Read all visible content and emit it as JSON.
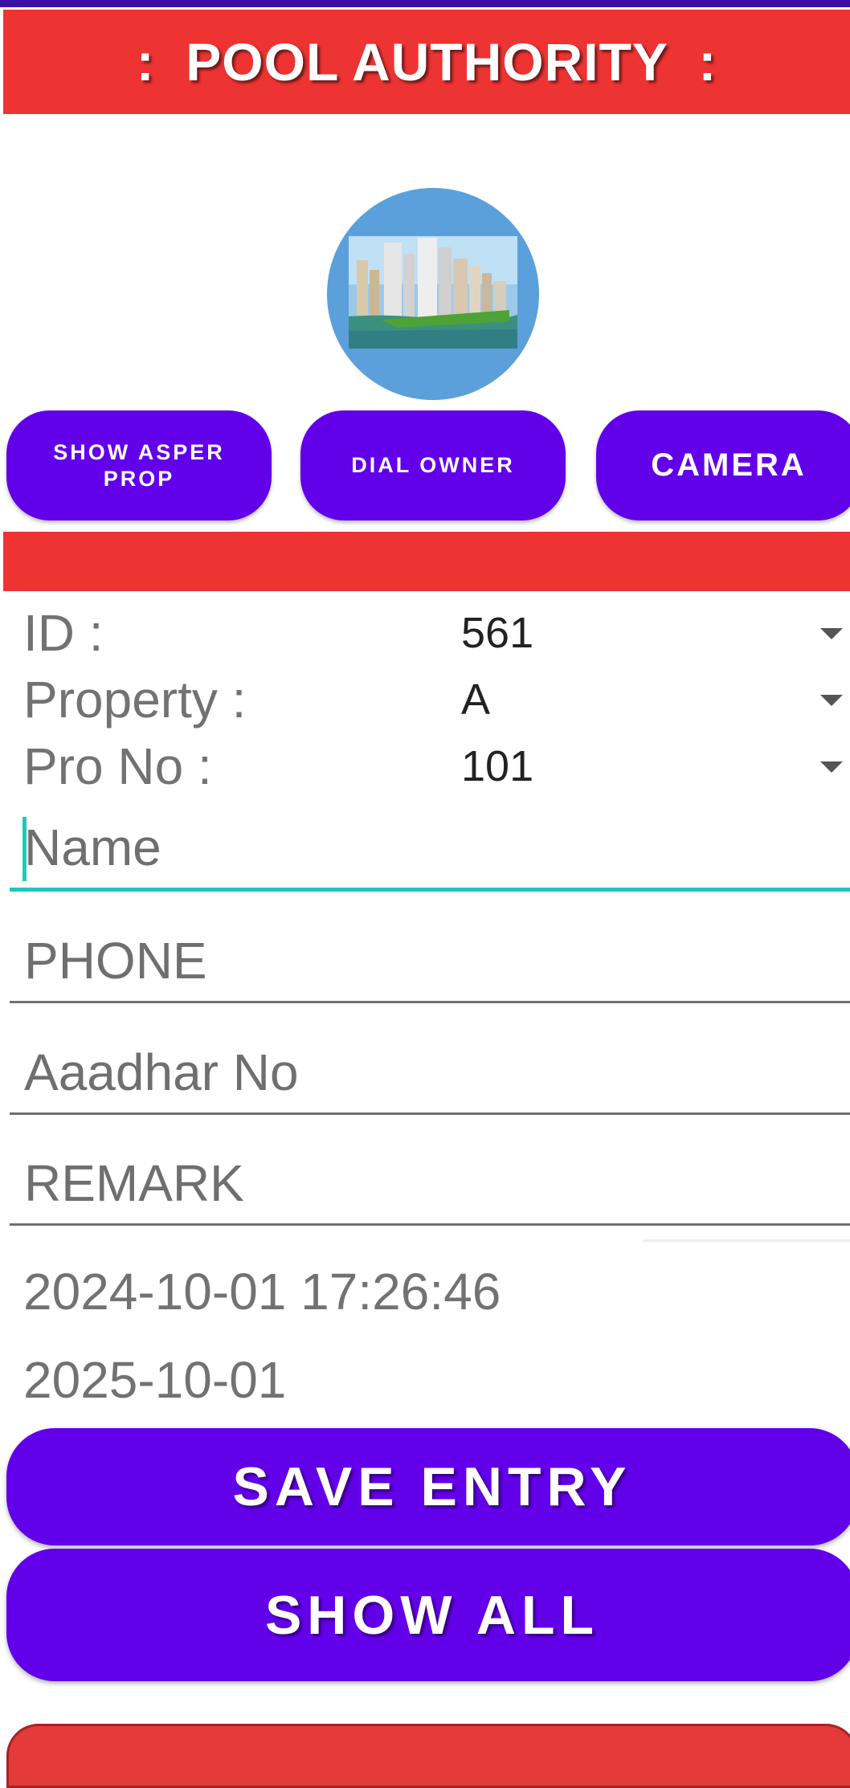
{
  "header": {
    "title": ":  POOL AUTHORITY  :"
  },
  "actions": {
    "show_asper_prop": "SHOW ASPER PROP",
    "dial_owner": "DIAL OWNER",
    "camera": "CAMERA"
  },
  "form": {
    "id_label": "ID :",
    "id_value": "561",
    "property_label": "Property :",
    "property_value": "A",
    "pro_no_label": "Pro No :",
    "pro_no_value": "101",
    "name_placeholder": "Name",
    "phone_placeholder": "PHONE",
    "aadhar_placeholder": "Aaadhar No",
    "remark_placeholder": "REMARK",
    "datetime": "2024-10-01 17:26:46",
    "expiry_date": "2025-10-01"
  },
  "buttons": {
    "save_entry": "SAVE ENTRY",
    "show_all": "SHOW ALL"
  },
  "colors": {
    "header_red": "#ee3333",
    "button_purple": "#6200ea",
    "focus_teal": "#20c7bd",
    "avatar_blue": "#5ba0da"
  },
  "icons": {
    "avatar": "city-skyline-image",
    "dropdown": "caret-down-icon"
  }
}
